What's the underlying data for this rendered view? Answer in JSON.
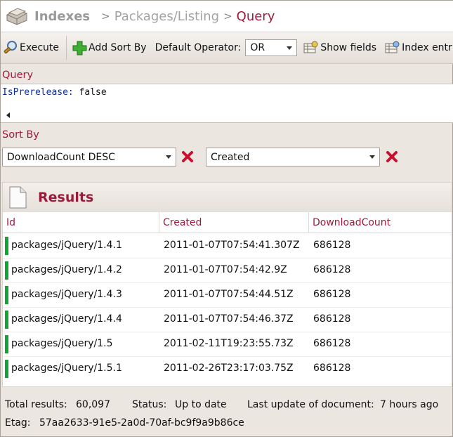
{
  "header": {
    "root": "Indexes",
    "sep": ">",
    "middle": "Packages/Listing",
    "current": "Query"
  },
  "toolbar": {
    "execute": "Execute",
    "add_sort_by": "Add Sort By",
    "default_operator_label": "Default Operator:",
    "default_operator_value": "OR",
    "show_fields": "Show fields",
    "index_entries": "Index entr"
  },
  "query": {
    "label": "Query",
    "key": "IsPrerelease:",
    "value": "false"
  },
  "sort": {
    "label": "Sort By",
    "first": "DownloadCount DESC",
    "second": "Created"
  },
  "results": {
    "title": "Results",
    "columns": [
      "Id",
      "Created",
      "DownloadCount"
    ],
    "rows": [
      {
        "id": "packages/jQuery/1.4.1",
        "created": "2011-01-07T07:54:41.307Z",
        "count": "686128"
      },
      {
        "id": "packages/jQuery/1.4.2",
        "created": "2011-01-07T07:54:42.9Z",
        "count": "686128"
      },
      {
        "id": "packages/jQuery/1.4.3",
        "created": "2011-01-07T07:54:44.51Z",
        "count": "686128"
      },
      {
        "id": "packages/jQuery/1.4.4",
        "created": "2011-01-07T07:54:46.37Z",
        "count": "686128"
      },
      {
        "id": "packages/jQuery/1.5",
        "created": "2011-02-11T19:23:55.73Z",
        "count": "686128"
      },
      {
        "id": "packages/jQuery/1.5.1",
        "created": "2011-02-26T23:17:03.75Z",
        "count": "686128"
      }
    ],
    "row_status_color": "#11a334"
  },
  "footer": {
    "total_label": "Total results:",
    "total_value": "60,097",
    "status_label": "Status:",
    "status_value": "Up to date",
    "last_update_label": "Last update of document:",
    "last_update_value": "7 hours ago",
    "etag_label": "Etag:",
    "etag_value": "57aa2633-91e5-2a0d-70af-bc9f9a9b86ce"
  },
  "colors": {
    "accent": "#9c1b3b",
    "query_key": "#0a2f9c",
    "remove_icon": "#c8102e"
  },
  "icons": [
    "database-icon",
    "execute-search-icon",
    "add-icon",
    "show-fields-icon",
    "index-entries-icon",
    "remove-sort-icon",
    "document-icon"
  ]
}
